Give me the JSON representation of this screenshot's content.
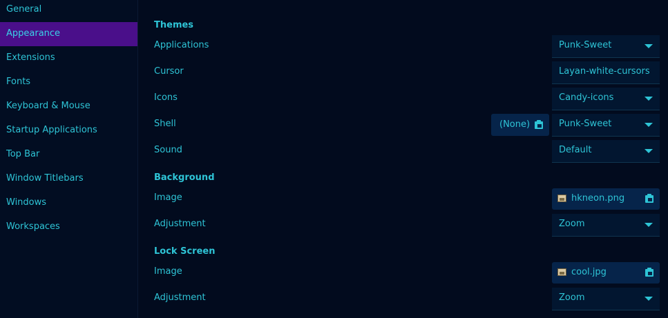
{
  "sidebar": {
    "items": [
      {
        "label": "General",
        "active": false
      },
      {
        "label": "Appearance",
        "active": true
      },
      {
        "label": "Extensions",
        "active": false
      },
      {
        "label": "Fonts",
        "active": false
      },
      {
        "label": "Keyboard & Mouse",
        "active": false
      },
      {
        "label": "Startup Applications",
        "active": false
      },
      {
        "label": "Top Bar",
        "active": false
      },
      {
        "label": "Window Titlebars",
        "active": false
      },
      {
        "label": "Windows",
        "active": false
      },
      {
        "label": "Workspaces",
        "active": false
      }
    ]
  },
  "themes": {
    "title": "Themes",
    "applications": {
      "label": "Applications",
      "value": "Punk-Sweet"
    },
    "cursor": {
      "label": "Cursor",
      "value": "Layan-white-cursors"
    },
    "icons": {
      "label": "Icons",
      "value": "Candy-icons"
    },
    "shell": {
      "label": "Shell",
      "value": "Punk-Sweet",
      "file_button": "(None)"
    },
    "sound": {
      "label": "Sound",
      "value": "Default"
    }
  },
  "background": {
    "title": "Background",
    "image": {
      "label": "Image",
      "value": "hkneon.png"
    },
    "adjustment": {
      "label": "Adjustment",
      "value": "Zoom"
    }
  },
  "lock_screen": {
    "title": "Lock Screen",
    "image": {
      "label": "Image",
      "value": "cool.jpg"
    },
    "adjustment": {
      "label": "Adjustment",
      "value": "Zoom"
    }
  },
  "colors": {
    "background": "#020b1e",
    "accent_text": "#2ec4d6",
    "active_item": "#4a0f8a",
    "button_bg": "#06244a"
  }
}
